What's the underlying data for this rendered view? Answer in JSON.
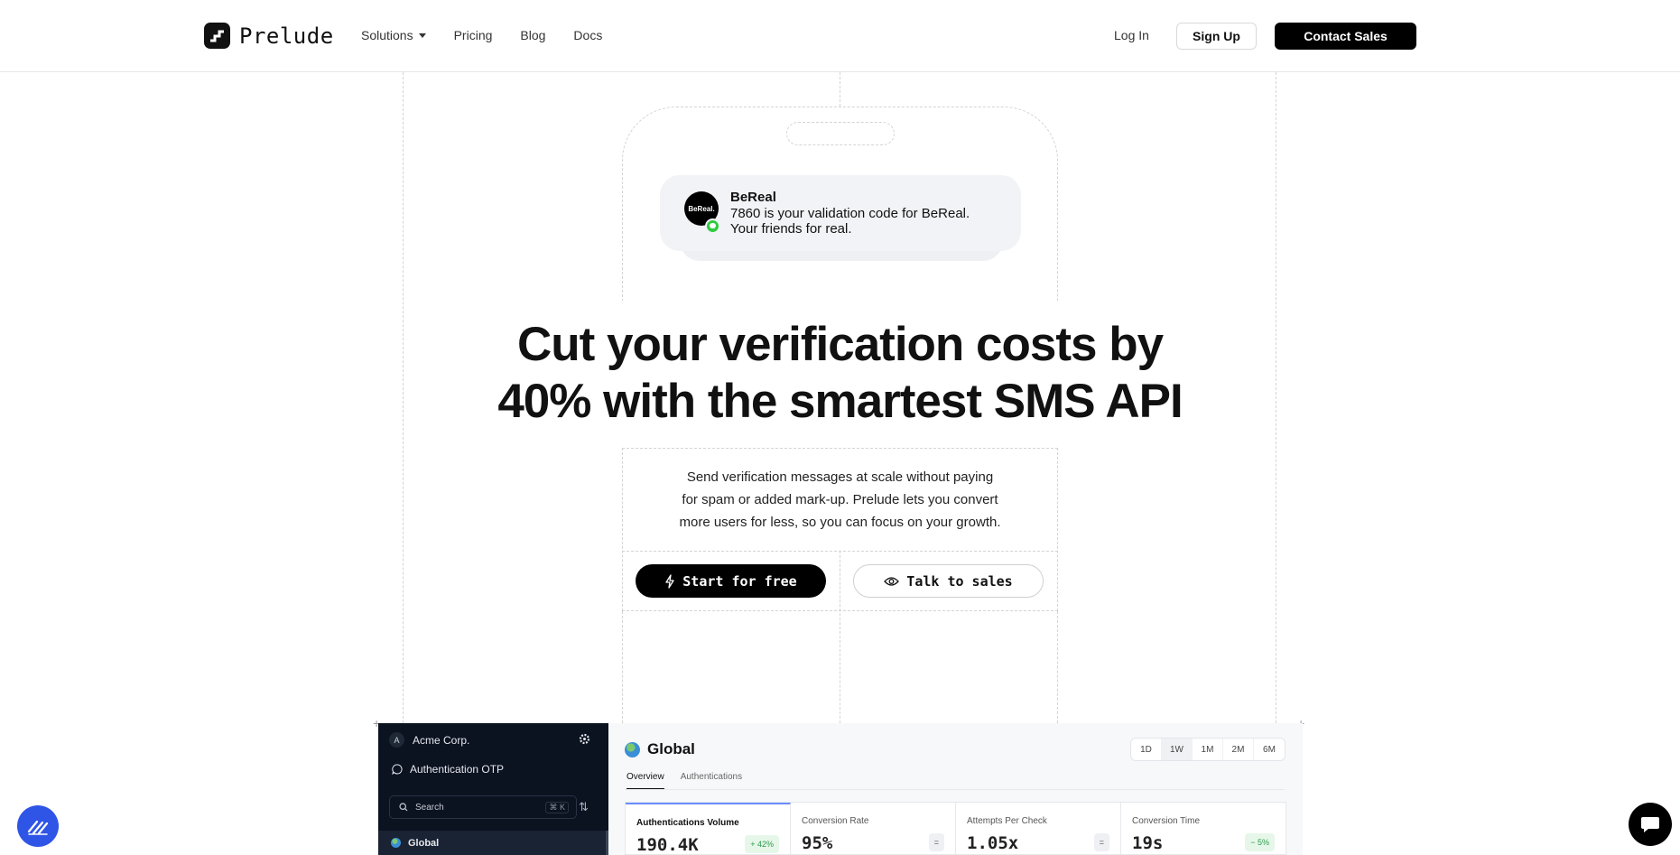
{
  "header": {
    "logo_text": "Prelude",
    "nav": [
      "Solutions",
      "Pricing",
      "Blog",
      "Docs"
    ],
    "login": "Log In",
    "signup": "Sign Up",
    "contact": "Contact Sales"
  },
  "notification": {
    "avatar_text": "BeReal.",
    "app": "BeReal",
    "line1": "7860 is your validation code for BeReal.",
    "line2": "Your friends for real."
  },
  "hero": {
    "title_line1": "Cut your verification costs by",
    "title_line2": "40% with the smartest SMS API",
    "desc_line1": "Send verification messages at scale without paying",
    "desc_line2": "for spam or added mark-up. Prelude lets you convert",
    "desc_line3": "more users for less, so you can focus on your growth.",
    "start_label": "Start for free",
    "talk_label": "Talk to sales"
  },
  "dashboard": {
    "sidebar": {
      "avatar_letter": "A",
      "org": "Acme Corp.",
      "project": "Authentication OTP",
      "search_placeholder": "Search",
      "search_shortcut": "⌘ K",
      "selected_region": "Global"
    },
    "main": {
      "title": "Global",
      "ranges": [
        "1D",
        "1W",
        "1M",
        "2M",
        "6M"
      ],
      "active_range": "1W",
      "tabs": [
        "Overview",
        "Authentications"
      ],
      "metrics": [
        {
          "label": "Authentications Volume",
          "value": "190.4K",
          "badge": "+ 42%",
          "badge_color": "green"
        },
        {
          "label": "Conversion Rate",
          "value": "95%",
          "badge": "=",
          "badge_color": "gray"
        },
        {
          "label": "Attempts Per Check",
          "value": "1.05x",
          "badge": "=",
          "badge_color": "gray"
        },
        {
          "label": "Conversion Time",
          "value": "19s",
          "badge": "− 5%",
          "badge_color": "green"
        }
      ]
    }
  },
  "colors": {
    "primary": "#000000",
    "sidebar_bg": "#0b1220",
    "accent_blue": "#2f55e6",
    "positive_green": "#2c9b49",
    "notif_green": "#2ecc40"
  }
}
